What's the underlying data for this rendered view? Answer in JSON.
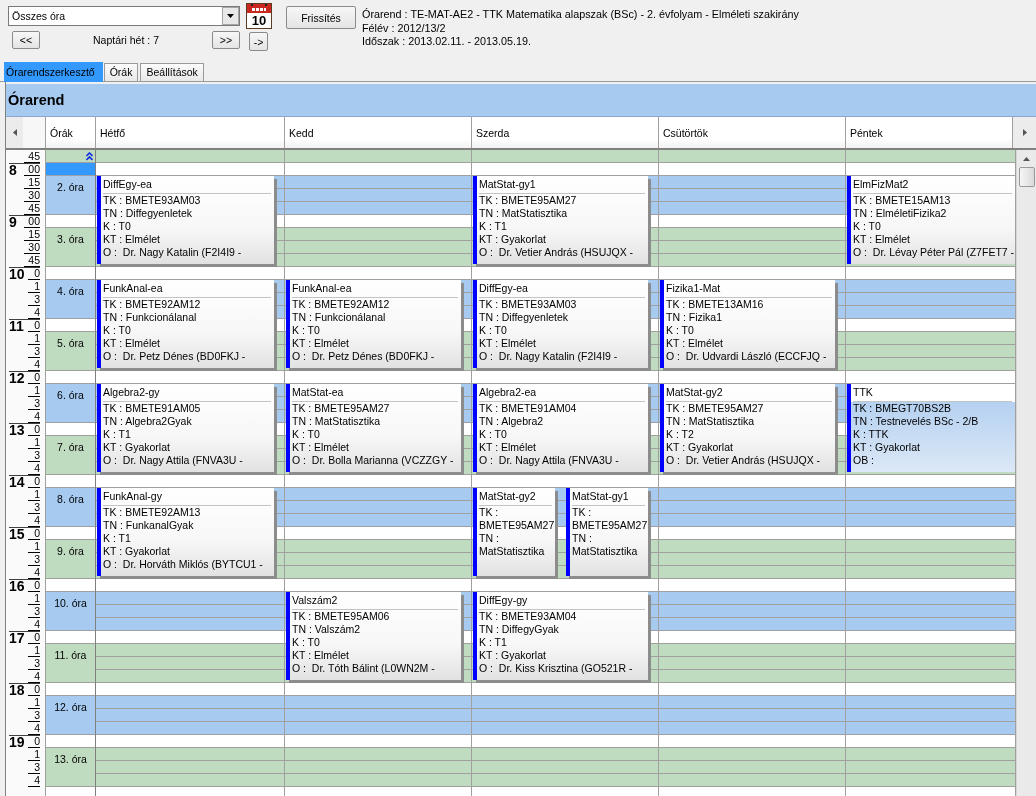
{
  "toolbar": {
    "filter": {
      "value": "Összes óra"
    },
    "calendar_day": "10",
    "refresh_button": "Frissítés",
    "prev_button": "<<",
    "week_label": "Naptári hét : 7",
    "next_button": ">>",
    "jump_button": "->"
  },
  "info": {
    "timetable": "Órarend : TE-MAT-AE2 - TTK Matematika alapszak (BSc) - 2. évfolyam - Elméleti szakirány",
    "semester": "Félév : 2012/13/2",
    "period": "Időszak : 2013.02.11. - 2013.05.19."
  },
  "tabs": [
    {
      "label": "Órarendszerkesztő",
      "selected": true
    },
    {
      "label": "Órák",
      "selected": false
    },
    {
      "label": "Beállítások",
      "selected": false
    }
  ],
  "panel_title": "Órarend",
  "header": {
    "lessons": "Órák",
    "days": [
      "Hétfő",
      "Kedd",
      "Szerda",
      "Csütörtök",
      "Péntek"
    ]
  },
  "time_scale": [
    {
      "minutes": [
        "45"
      ]
    },
    {
      "hour": "8",
      "minutes": [
        "00",
        "15",
        "30",
        "45"
      ]
    },
    {
      "hour": "9",
      "minutes": [
        "00",
        "15",
        "30",
        "45"
      ]
    },
    {
      "hour": "10",
      "minutes": [
        "0",
        "1",
        "3",
        "4"
      ]
    },
    {
      "hour": "11",
      "minutes": [
        "0",
        "1",
        "3",
        "4"
      ]
    },
    {
      "hour": "12",
      "minutes": [
        "0",
        "1",
        "3",
        "4"
      ]
    },
    {
      "hour": "13",
      "minutes": [
        "0",
        "1",
        "3",
        "4"
      ]
    },
    {
      "hour": "14",
      "minutes": [
        "0",
        "1",
        "3",
        "4"
      ]
    },
    {
      "hour": "15",
      "minutes": [
        "0",
        "1",
        "3",
        "4"
      ]
    },
    {
      "hour": "16",
      "minutes": [
        "0",
        "1",
        "3",
        "4"
      ]
    },
    {
      "hour": "17",
      "minutes": [
        "0",
        "1",
        "3",
        "4"
      ]
    },
    {
      "hour": "18",
      "minutes": [
        "0",
        "1",
        "3",
        "4"
      ]
    },
    {
      "hour": "19",
      "minutes": [
        "0",
        "1",
        "3",
        "4"
      ]
    }
  ],
  "start_row": {
    "selected": true
  },
  "blocks": [
    {
      "lessons": [
        "2. óra",
        "3. óra"
      ],
      "days": [
        {
          "kind": "booked",
          "cards": [
            {
              "title": "DiffEgy-ea",
              "lines": [
                "TK : BMETE93AM03",
                "TN : Diffegyenletek",
                "K : T0",
                "KT : Elmélet",
                "O :  Dr. Nagy Katalin (F2I4I9 -"
              ],
              "selected": false
            }
          ]
        },
        {
          "kind": "free"
        },
        {
          "kind": "booked",
          "cards": [
            {
              "title": "MatStat-gy1",
              "lines": [
                "TK : BMETE95AM27",
                "TN : MatStatisztika",
                "K : T1",
                "KT : Gyakorlat",
                "O :  Dr. Vetier András (HSUJQX -"
              ],
              "selected": false
            }
          ]
        },
        {
          "kind": "free"
        },
        {
          "kind": "booked",
          "cards": [
            {
              "title": "ElmFizMat2",
              "lines": [
                "TK : BMETE15AM13",
                "TN : ElméletiFizika2",
                "K : T0",
                "KT : Elmélet",
                "O :  Dr. Lévay Péter Pál (Z7FET7 -"
              ],
              "selected": false
            }
          ]
        }
      ]
    },
    {
      "lessons": [
        "4. óra",
        "5. óra"
      ],
      "days": [
        {
          "kind": "booked",
          "cards": [
            {
              "title": "FunkAnal-ea",
              "lines": [
                "TK : BMETE92AM12",
                "TN : Funkcionálanal",
                "K : T0",
                "KT : Elmélet",
                "O :  Dr. Petz Dénes (BD0FKJ -"
              ],
              "selected": false
            }
          ]
        },
        {
          "kind": "booked",
          "cards": [
            {
              "title": "FunkAnal-ea",
              "lines": [
                "TK : BMETE92AM12",
                "TN : Funkcionálanal",
                "K : T0",
                "KT : Elmélet",
                "O :  Dr. Petz Dénes (BD0FKJ -"
              ],
              "selected": false
            }
          ]
        },
        {
          "kind": "booked",
          "cards": [
            {
              "title": "DiffEgy-ea",
              "lines": [
                "TK : BMETE93AM03",
                "TN : Diffegyenletek",
                "K : T0",
                "KT : Elmélet",
                "O :  Dr. Nagy Katalin (F2I4I9 -"
              ],
              "selected": false
            }
          ]
        },
        {
          "kind": "booked",
          "cards": [
            {
              "title": "Fizika1-Mat",
              "lines": [
                "TK : BMETE13AM16",
                "TN : Fizika1",
                "K : T0",
                "KT : Elmélet",
                "O :  Dr. Udvardi László (ECCFJQ -"
              ],
              "selected": false
            }
          ]
        },
        {
          "kind": "free"
        }
      ]
    },
    {
      "lessons": [
        "6. óra",
        "7. óra"
      ],
      "days": [
        {
          "kind": "booked",
          "cards": [
            {
              "title": "Algebra2-gy",
              "lines": [
                "TK : BMETE91AM05",
                "TN : Algebra2Gyak",
                "K : T1",
                "KT : Gyakorlat",
                "O :  Dr. Nagy Attila (FNVA3U -"
              ],
              "selected": false
            }
          ]
        },
        {
          "kind": "booked",
          "cards": [
            {
              "title": "MatStat-ea",
              "lines": [
                "TK : BMETE95AM27",
                "TN : MatStatisztika",
                "K : T0",
                "KT : Elmélet",
                "O :  Dr. Bolla Marianna (VCZZGY -"
              ],
              "selected": false
            }
          ]
        },
        {
          "kind": "booked",
          "cards": [
            {
              "title": "Algebra2-ea",
              "lines": [
                "TK : BMETE91AM04",
                "TN : Algebra2",
                "K : T0",
                "KT : Elmélet",
                "O :  Dr. Nagy Attila (FNVA3U -"
              ],
              "selected": false
            }
          ]
        },
        {
          "kind": "booked",
          "cards": [
            {
              "title": "MatStat-gy2",
              "lines": [
                "TK : BMETE95AM27",
                "TN : MatStatisztika",
                "K : T2",
                "KT : Gyakorlat",
                "O :  Dr. Vetier András (HSUJQX -"
              ],
              "selected": false
            }
          ]
        },
        {
          "kind": "booked",
          "cards": [
            {
              "title": "TTK",
              "lines": [
                "TK : BMEGT70BS2B",
                "TN : Testnevelés BSc - 2/B",
                "K : TTK",
                "KT : Gyakorlat",
                "OB :"
              ],
              "selected": true
            }
          ]
        }
      ]
    },
    {
      "lessons": [
        "8. óra",
        "9. óra"
      ],
      "days": [
        {
          "kind": "booked",
          "cards": [
            {
              "title": "FunkAnal-gy",
              "lines": [
                "TK : BMETE92AM13",
                "TN : FunkanalGyak",
                "K : T1",
                "KT : Gyakorlat",
                "O :  Dr. Horváth Miklós (BYTCU1 -"
              ],
              "selected": false
            }
          ]
        },
        {
          "kind": "free"
        },
        {
          "kind": "booked",
          "cards": [
            {
              "title": "MatStat-gy2",
              "lines": [
                "TK : BMETE95AM27",
                "TN : MatStatisztika"
              ],
              "selected": false
            },
            {
              "title": "MatStat-gy1",
              "lines": [
                "TK : BMETE95AM27",
                "TN : MatStatisztika"
              ],
              "selected": false
            }
          ]
        },
        {
          "kind": "free"
        },
        {
          "kind": "free"
        }
      ]
    },
    {
      "lessons": [
        "10. óra",
        "11. óra"
      ],
      "days": [
        {
          "kind": "free"
        },
        {
          "kind": "booked",
          "cards": [
            {
              "title": "Valszám2",
              "lines": [
                "TK : BMETE95AM06",
                "TN : Valszám2",
                "K : T0",
                "KT : Elmélet",
                "O :  Dr. Tóth Bálint (L0WN2M -"
              ],
              "selected": false
            }
          ]
        },
        {
          "kind": "booked",
          "cards": [
            {
              "title": "DiffEgy-gy",
              "lines": [
                "TK : BMETE93AM04",
                "TN : DiffegyGyak",
                "K : T1",
                "KT : Gyakorlat",
                "O :  Dr. Kiss Krisztina (GO521R -"
              ],
              "selected": false
            }
          ]
        },
        {
          "kind": "free"
        },
        {
          "kind": "free"
        }
      ]
    },
    {
      "lessons": [
        "12. óra",
        "13. óra"
      ],
      "days": [
        {
          "kind": "free"
        },
        {
          "kind": "free"
        },
        {
          "kind": "free"
        },
        {
          "kind": "free"
        },
        {
          "kind": "free"
        }
      ]
    }
  ]
}
